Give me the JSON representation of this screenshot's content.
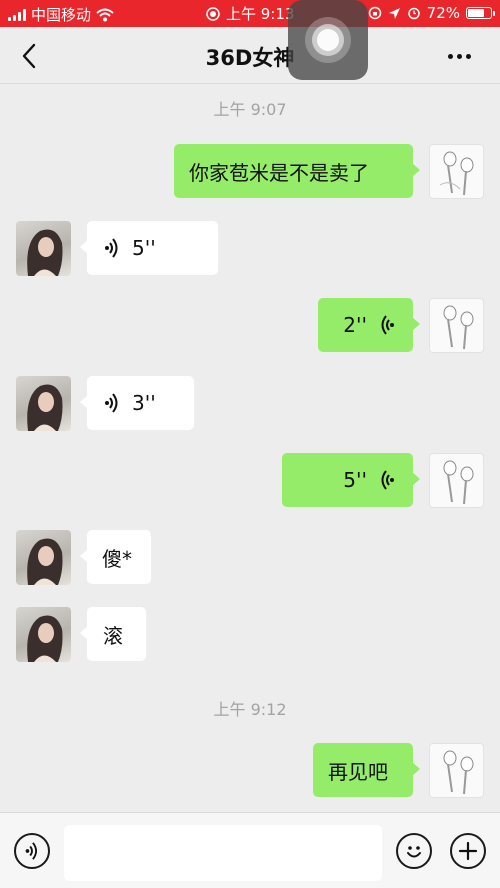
{
  "status_bar": {
    "carrier": "中国移动",
    "time": "上午 9:13",
    "battery": "72%",
    "battery_level": 0.72,
    "color": "#e8262b"
  },
  "nav": {
    "title": "36D女神",
    "back_icon": "chevron-left-icon",
    "more_icon": "more-dots-icon"
  },
  "chat": {
    "timestamps": [
      "上午 9:07",
      "上午 9:12"
    ],
    "messages": [
      {
        "sender": "me",
        "type": "text",
        "text": "你家苞米是不是卖了"
      },
      {
        "sender": "her",
        "type": "voice",
        "duration": "5''"
      },
      {
        "sender": "me",
        "type": "voice",
        "duration": "2''"
      },
      {
        "sender": "her",
        "type": "voice",
        "duration": "3''"
      },
      {
        "sender": "me",
        "type": "voice",
        "duration": "5''"
      },
      {
        "sender": "her",
        "type": "text",
        "text": "傻*"
      },
      {
        "sender": "her",
        "type": "text",
        "text": "滚"
      },
      {
        "sender": "me",
        "type": "text",
        "text": "再见吧"
      }
    ],
    "colors": {
      "me_bubble": "#95ec69",
      "her_bubble": "#ffffff",
      "background": "#ededed"
    }
  },
  "input_bar": {
    "voice_icon": "voice-input-icon",
    "emoji_icon": "emoji-icon",
    "plus_icon": "plus-icon",
    "value": ""
  }
}
